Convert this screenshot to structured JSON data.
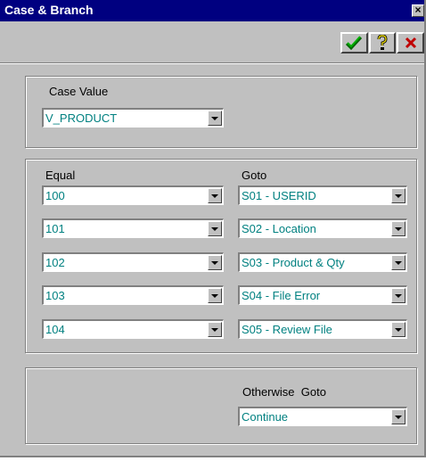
{
  "window": {
    "title": "Case & Branch",
    "close_glyph": "×"
  },
  "toolbar": {
    "buttons": [
      {
        "name": "ok-button",
        "icon": "checkmark-icon"
      },
      {
        "name": "help-button",
        "icon": "question-icon"
      },
      {
        "name": "cancel-button",
        "icon": "x-icon"
      }
    ]
  },
  "case": {
    "label": "Case Value",
    "value": "V_PRODUCT"
  },
  "mapping": {
    "equal_header": "Equal",
    "goto_header": "Goto",
    "rows": [
      {
        "equal": "100",
        "goto": "S01 - USERID"
      },
      {
        "equal": "101",
        "goto": "S02 - Location"
      },
      {
        "equal": "102",
        "goto": "S03 - Product & Qty"
      },
      {
        "equal": "103",
        "goto": "S04 - File Error"
      },
      {
        "equal": "104",
        "goto": "S05 - Review File"
      }
    ]
  },
  "otherwise": {
    "label": "Otherwise  Goto",
    "value": "Continue"
  },
  "colors": {
    "title_bar": "#000080",
    "value_text": "#008080",
    "face": "#c0c0c0"
  }
}
